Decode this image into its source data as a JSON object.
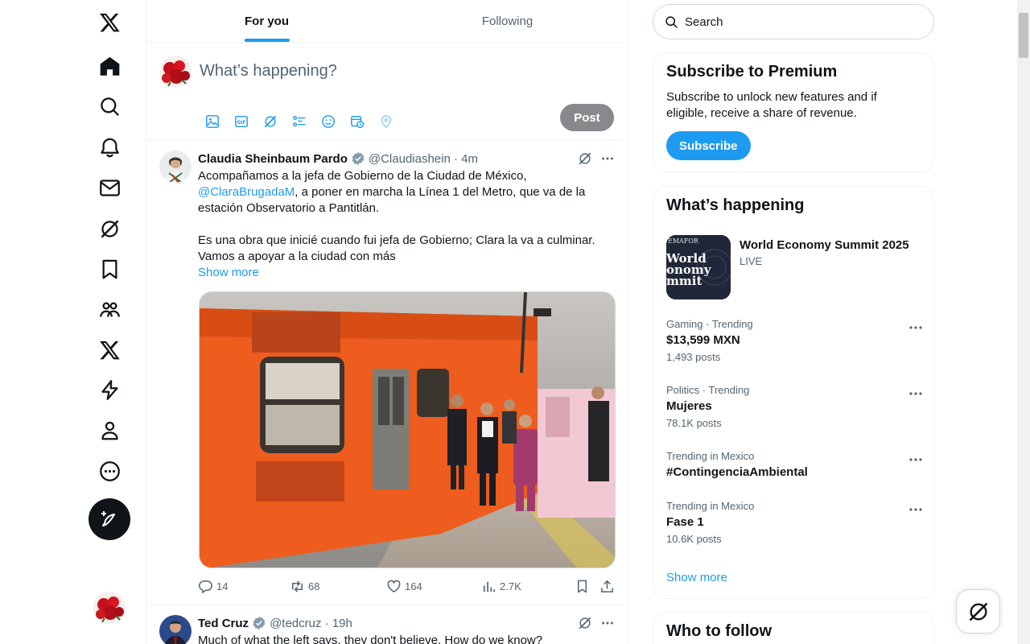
{
  "nav": {
    "items": [
      "home",
      "explore",
      "notifications",
      "messages",
      "grok",
      "bookmarks",
      "communities",
      "premium",
      "verified-orgs",
      "profile",
      "more"
    ]
  },
  "tabs": [
    {
      "label": "For you",
      "active": true
    },
    {
      "label": "Following",
      "active": false
    }
  ],
  "composer": {
    "placeholder": "What’s happening?",
    "post_label": "Post"
  },
  "tweets": [
    {
      "name": "Claudia Sheinbaum Pardo",
      "handle": "@Claudiashein",
      "time": "4m",
      "text_before_link": "Acompañamos a la jefa de Gobierno de la Ciudad de México,",
      "link": "@ClaraBrugadaM",
      "text_after_link": ", a poner en marcha la Línea 1 del Metro, que va de la estación Observatorio a Pantitlán.",
      "text_para2": "Es una obra que inicié cuando fui jefa de Gobierno; Clara la va a culminar. Vamos a apoyar a la ciudad con más",
      "show_more": "Show more",
      "replies": "14",
      "reposts": "68",
      "likes": "164",
      "views": "2.7K"
    },
    {
      "name": "Ted Cruz",
      "handle": "@tedcruz",
      "time": "19h",
      "text": "Much of what the left says, they don't believe. How do we know?"
    }
  ],
  "search": {
    "placeholder": "Search"
  },
  "premium": {
    "title": "Subscribe to Premium",
    "text": "Subscribe to unlock new features and if eligible, receive a share of revenue.",
    "button": "Subscribe"
  },
  "happening": {
    "title": "What’s happening",
    "event": {
      "title": "World Economy Summit 2025",
      "status": "LIVE",
      "image_text": [
        "EMAFOR",
        "World",
        "onomy",
        "mmit"
      ]
    },
    "trends": [
      {
        "meta": "Gaming · Trending",
        "name": "$13,599 MXN",
        "count": "1,493 posts"
      },
      {
        "meta": "Politics · Trending",
        "name": "Mujeres",
        "count": "78.1K posts"
      },
      {
        "meta": "Trending in Mexico",
        "name": "#ContingenciaAmbiental",
        "count": ""
      },
      {
        "meta": "Trending in Mexico",
        "name": "Fase 1",
        "count": "10.6K posts"
      }
    ],
    "show_more": "Show more"
  },
  "who_to_follow": {
    "title": "Who to follow"
  },
  "colors": {
    "accent": "#1d9bf0",
    "text": "#0f1419",
    "muted": "#536471",
    "border": "#eff3f4"
  }
}
